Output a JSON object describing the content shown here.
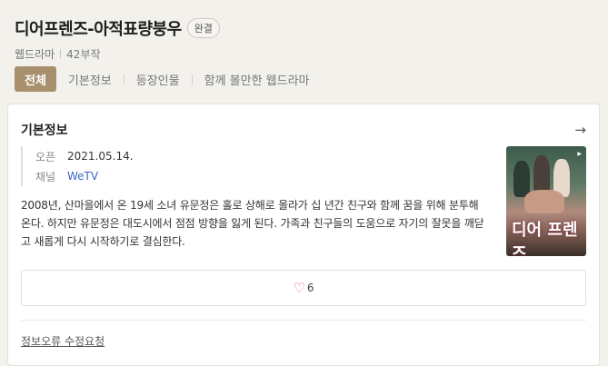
{
  "title": "디어프렌즈-아적표량붕우",
  "status_badge": "완결",
  "meta": {
    "genre": "웹드라마",
    "episodes": "42부작"
  },
  "tabs": [
    {
      "label": "전체",
      "active": true
    },
    {
      "label": "기본정보",
      "active": false
    },
    {
      "label": "등장인물",
      "active": false
    },
    {
      "label": "함께 볼만한 웹드라마",
      "active": false
    }
  ],
  "info": {
    "section_title": "기본정보",
    "open_label": "오픈",
    "open_value": "2021.05.14.",
    "channel_label": "채널",
    "channel_value": "WeTV",
    "description": "2008년, 산마을에서 온 19세 소녀 유문정은 홀로 상해로 올라가 십 년간 친구와 함께 꿈을 위해 분투해 온다. 하지만 유문정은 대도시에서 점점 방향을 잃게 된다. 가족과 친구들의 도움으로 자기의 잘못을 깨닫고 새롭게 다시 시작하기로 결심한다.",
    "poster_title": "디어 프렌즈"
  },
  "likes": "6",
  "report_link": "정보오류 수정요청",
  "colors": {
    "accent": "#a8906d",
    "link": "#3a66c5",
    "heart": "#e36d6d"
  }
}
